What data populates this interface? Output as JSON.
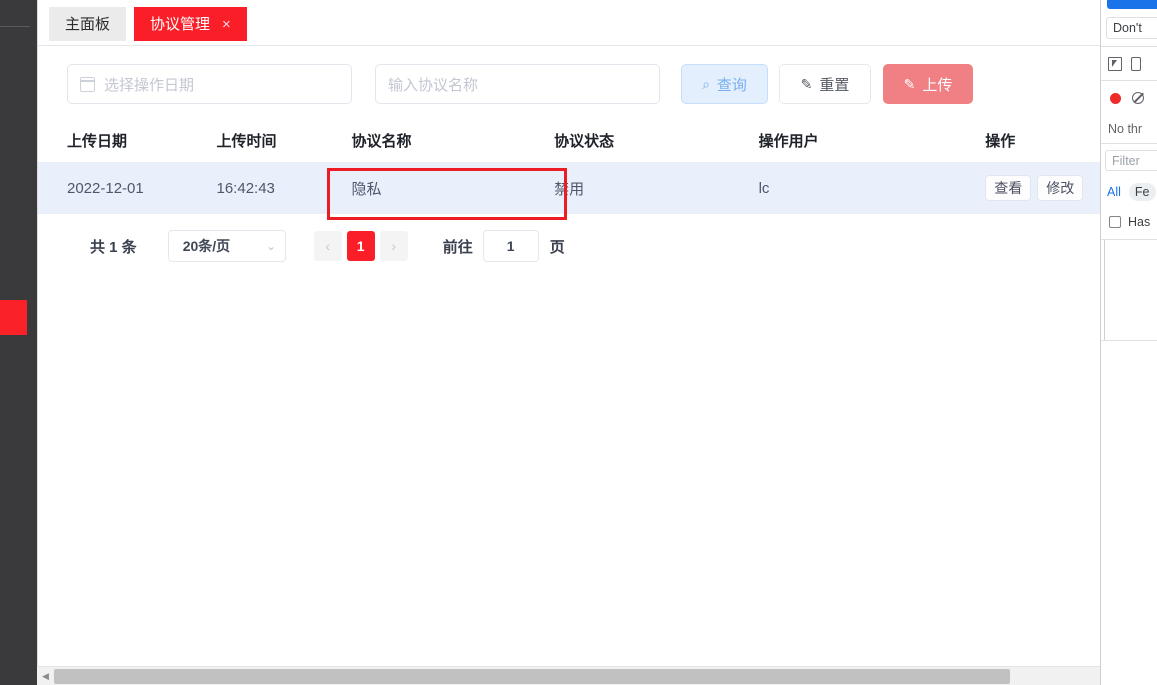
{
  "app": {
    "tabs": [
      {
        "label": "主面板",
        "active": false,
        "closable": false
      },
      {
        "label": "协议管理",
        "active": true,
        "closable": true,
        "close_glyph": "×"
      }
    ]
  },
  "filter_bar": {
    "date_placeholder": "选择操作日期",
    "name_placeholder": "输入协议名称",
    "query_label": "查询",
    "query_icon": "search-icon",
    "query_glyph": "⌕",
    "reset_label": "重置",
    "reset_glyph": "✎",
    "upload_label": "上传",
    "upload_glyph": "✎",
    "accent_red": "#fa1e28",
    "upload_bg": "#f08084",
    "query_bg": "#e3effd"
  },
  "table": {
    "columns": [
      "上传日期",
      "上传时间",
      "协议名称",
      "协议状态",
      "操作用户",
      "操作"
    ],
    "rows": [
      {
        "upload_date": "2022-12-01",
        "upload_time": "16:42:43",
        "agreement_name": "隐私",
        "status": "禁用",
        "operator": "lc",
        "actions": [
          "查看",
          "修改"
        ]
      }
    ],
    "row_highlight_color": "#eaf0fb"
  },
  "annotation": {
    "shape": "rectangle",
    "color": "#ec1c24",
    "targets": "协议名称 cell"
  },
  "pagination": {
    "total_text": "共 1 条",
    "page_size": "20条/页",
    "caret_glyph": "⌄",
    "prev_glyph": "‹",
    "next_glyph": "›",
    "current_page": "1",
    "goto_label": "前往",
    "goto_value": "1",
    "goto_unit": "页"
  },
  "scrollbar": {
    "left_arrow": "◀",
    "right_arrow": "▶"
  },
  "devtools": {
    "dont_text": "Don't",
    "no_throttling": "No thr",
    "filter_placeholder": "Filter",
    "type_all": "All",
    "type_fetch": "Fe",
    "has_blocked": "Has",
    "inspect_icon": "inspect-element-icon",
    "device_icon": "device-toolbar-icon",
    "record_icon": "record-icon",
    "clear_icon": "clear-icon"
  }
}
